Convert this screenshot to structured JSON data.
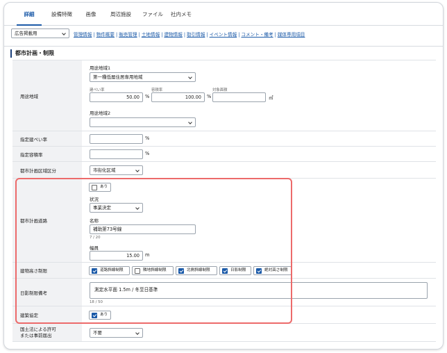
{
  "tabs": [
    "詳細",
    "設備特徴",
    "画像",
    "周辺施設",
    "ファイル",
    "社内メモ"
  ],
  "filter": {
    "selected": "広告掲載用"
  },
  "jump_links": [
    "管理情報",
    "物件概要",
    "販売管理",
    "土地情報",
    "建物情報",
    "取引情報",
    "イベント情報",
    "コメント・備考",
    "媒体専用項目"
  ],
  "section_title": "都市計画・制限",
  "youto": {
    "label": "用途地域",
    "zone1_label": "用途地域1",
    "zone1_value": "第一種低層住居専用地域",
    "kenpei_label": "建ぺい率",
    "kenpei_value": "50.00",
    "yoseki_label": "容積率",
    "yoseki_value": "100.00",
    "menseki_label": "対象面積",
    "menseki_value": "",
    "percent": "%",
    "sqm": "㎡",
    "zone2_label": "用途地域2",
    "zone2_value": ""
  },
  "shitei_kenpei": {
    "label": "指定建ぺい率",
    "value": "",
    "unit": "%"
  },
  "shitei_yoseki": {
    "label": "指定容積率",
    "value": "",
    "unit": "%"
  },
  "toshi_kukaku": {
    "label": "都市計画区域区分",
    "value": "市街化区域"
  },
  "toshi_road": {
    "label": "都市計画道路",
    "ari_label": "あり",
    "status_label": "状況",
    "status_value": "事業決定",
    "name_label": "名称",
    "name_value": "補助第73号線",
    "name_count": "7 / 20",
    "width_label": "幅員",
    "width_value": "15.00",
    "width_unit": "m"
  },
  "height_limit": {
    "label": "建物高さ制限",
    "options": [
      {
        "label": "道路斜線制限",
        "checked": true
      },
      {
        "label": "隣地斜線制限",
        "checked": false
      },
      {
        "label": "北側斜線制限",
        "checked": true
      },
      {
        "label": "日影制限",
        "checked": true
      },
      {
        "label": "絶対高さ制限",
        "checked": true
      }
    ]
  },
  "shadow_note": {
    "label": "日影制限備考",
    "value": "測定水平面 1.5m / 冬至日基準",
    "count": "18 / 50"
  },
  "kenchiku_kyotei": {
    "label": "建築協定",
    "ari_label": "あり"
  },
  "kokudo": {
    "label_line1": "国土法による許可",
    "label_line2": "または事前届出",
    "value": "不要"
  },
  "colors": {
    "accent": "#1b5aa8",
    "highlight": "#ec6a6a",
    "label_bg": "#f1f2f4"
  }
}
